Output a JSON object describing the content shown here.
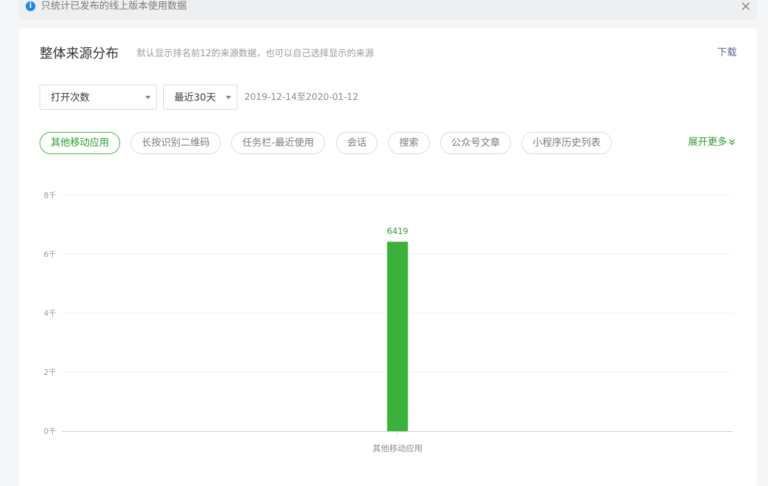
{
  "notice": {
    "icon": "info-icon",
    "text": "只统计已发布的线上版本使用数据"
  },
  "card": {
    "title": "整体来源分布",
    "subtitle": "默认显示排名前12的来源数据，也可以自己选择显示的来源",
    "download_label": "下载"
  },
  "filters": {
    "metric_value": "打开次数",
    "range_value": "最近30天",
    "date_range": "2019-12-14至2020-01-12"
  },
  "tags": [
    {
      "label": "其他移动应用",
      "active": true
    },
    {
      "label": "长按识别二维码",
      "active": false
    },
    {
      "label": "任务栏-最近使用",
      "active": false
    },
    {
      "label": "会话",
      "active": false
    },
    {
      "label": "搜索",
      "active": false
    },
    {
      "label": "公众号文章",
      "active": false
    },
    {
      "label": "小程序历史列表",
      "active": false
    }
  ],
  "expand_more_label": "展开更多",
  "colors": {
    "accent": "#3bb13b",
    "bar": "#3ab13a",
    "link": "#576b95"
  },
  "chart_data": {
    "type": "bar",
    "categories": [
      "其他移动应用"
    ],
    "values": [
      6419
    ],
    "ylim": [
      0,
      8000
    ],
    "yticks": [
      0,
      2000,
      4000,
      6000,
      8000
    ],
    "ytick_labels": [
      "0千",
      "2千",
      "4千",
      "6千",
      "8千"
    ],
    "grid": true,
    "data_labels": [
      "6419"
    ]
  }
}
